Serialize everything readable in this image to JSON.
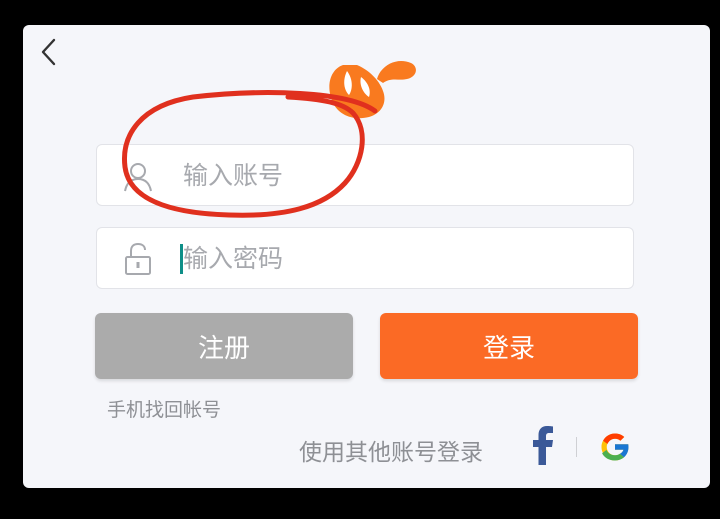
{
  "login": {
    "account_placeholder": "输入账号",
    "password_placeholder": "输入密码",
    "register_label": "注册",
    "login_label": "登录",
    "phone_recover_link": "手机找回帐号",
    "other_accounts_label": "使用其他账号登录"
  },
  "colors": {
    "accent": "#fb6a25",
    "register_button": "#ababab",
    "annotation": "#e0301e",
    "caret": "#0e8f88",
    "facebook": "#3b5998"
  },
  "icons": [
    "back-arrow-icon",
    "brand-logo",
    "user-icon",
    "lock-icon",
    "facebook-icon",
    "google-icon"
  ]
}
